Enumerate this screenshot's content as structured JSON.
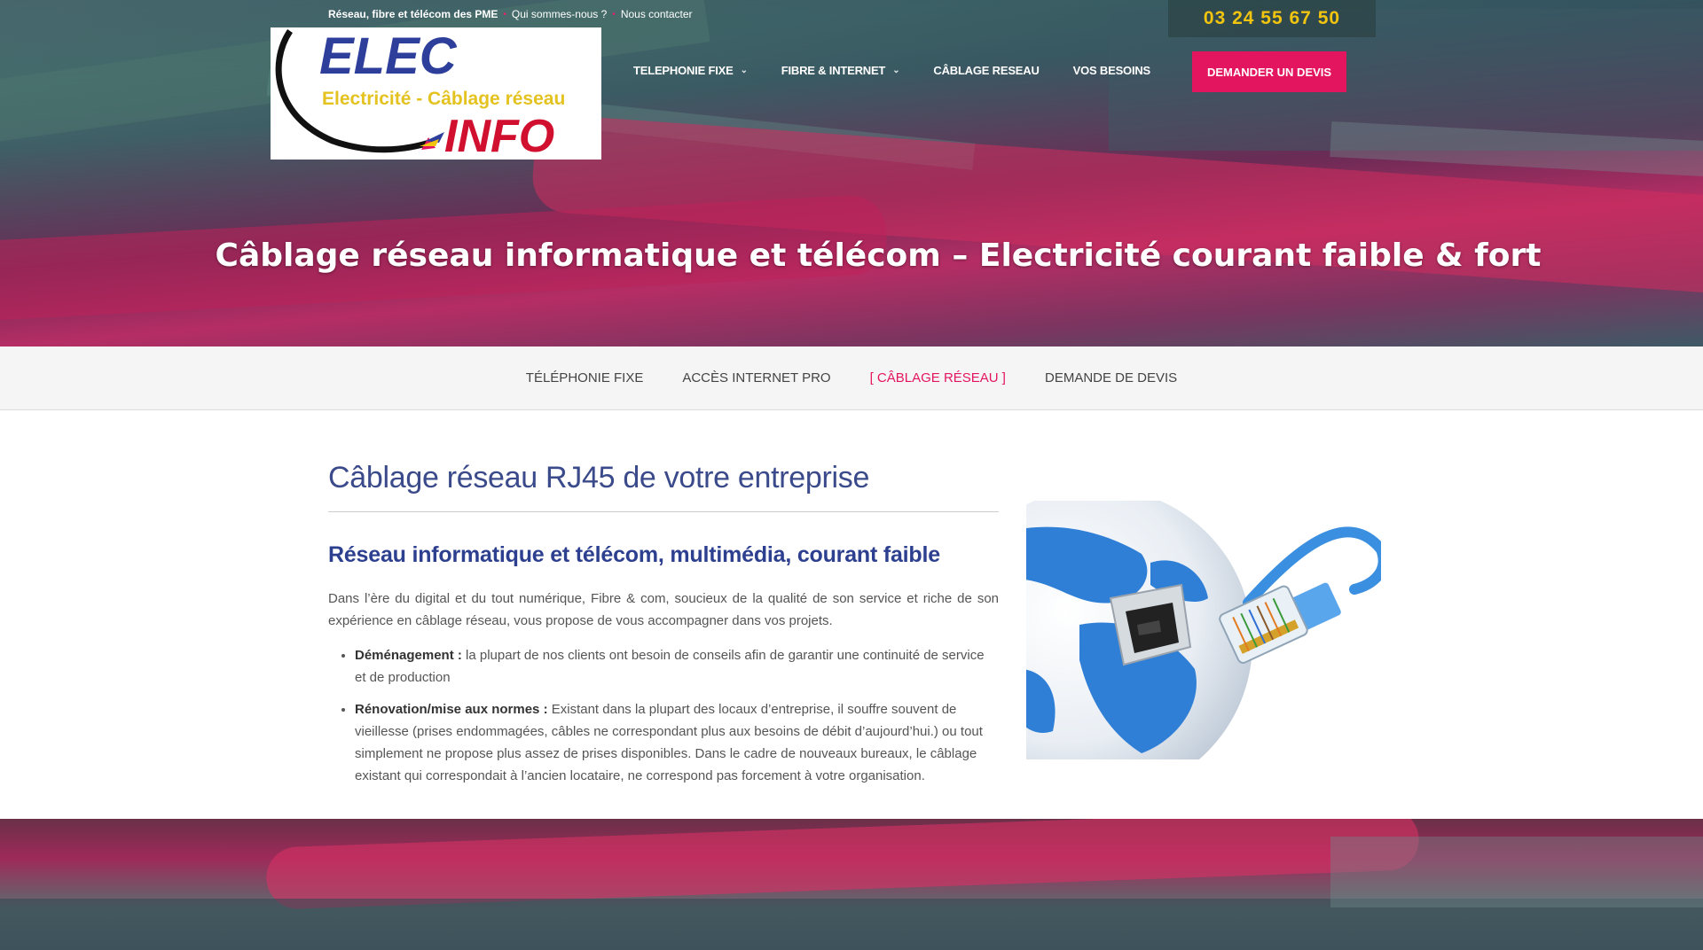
{
  "top_bar": {
    "tagline": "Réseau, fibre et télécom des PME",
    "link_about": "Qui sommes-nous ?",
    "link_contact": "Nous contacter"
  },
  "phone": "03 24 55 67 50",
  "logo": {
    "line1": "ELEC",
    "line2": "Electricité - Câblage réseau",
    "line3": "INFO"
  },
  "main_nav": {
    "items": [
      {
        "label": "TELEPHONIE FIXE",
        "has_dropdown": true
      },
      {
        "label": "FIBRE & INTERNET",
        "has_dropdown": true
      },
      {
        "label": "CÂBLAGE RESEAU",
        "has_dropdown": false
      },
      {
        "label": "VOS BESOINS",
        "has_dropdown": false
      }
    ],
    "cta_label": "DEMANDER UN DEVIS"
  },
  "hero": {
    "title": "Câblage réseau informatique et télécom – Electricité courant faible & fort"
  },
  "sub_nav": {
    "items": [
      {
        "label": "TÉLÉPHONIE FIXE",
        "active": false
      },
      {
        "label": "ACCÈS INTERNET PRO",
        "active": false
      },
      {
        "label": "[  CÂBLAGE RÉSEAU  ]",
        "active": true
      },
      {
        "label": "DEMANDE DE DEVIS",
        "active": false
      }
    ]
  },
  "content": {
    "heading": "Câblage réseau RJ45 de votre entreprise",
    "subheading": "Réseau informatique et télécom, multimédia, courant faible",
    "intro": "Dans l’ère du digital et du tout numérique, Fibre & com, soucieux de la qualité de son service et riche de son expérience en câblage réseau, vous propose de vous accompagner dans vos projets.",
    "bullets": [
      {
        "title": "Déménagement :",
        "text": " la plupart de nos clients ont besoin de conseils afin de garantir une continuité de service et de production"
      },
      {
        "title": "Rénovation/mise aux normes :",
        "text": " Existant dans la plupart des locaux d’entreprise, il souffre souvent de vieillesse (prises endommagées, câbles ne correspondant plus aux besoins de débit d’aujourd’hui.) ou tout simplement ne propose plus assez de prises disponibles. Dans le cadre de nouveaux bureaux, le câblage existant qui correspondait à l’ancien locataire, ne correspond pas forcement à votre organisation."
      }
    ]
  },
  "colors": {
    "accent": "#e3155f",
    "phone": "#f1c40f",
    "heading": "#3a4a8a"
  },
  "icons": [
    "chevron-down-icon",
    "globe-rj45-illustration"
  ]
}
